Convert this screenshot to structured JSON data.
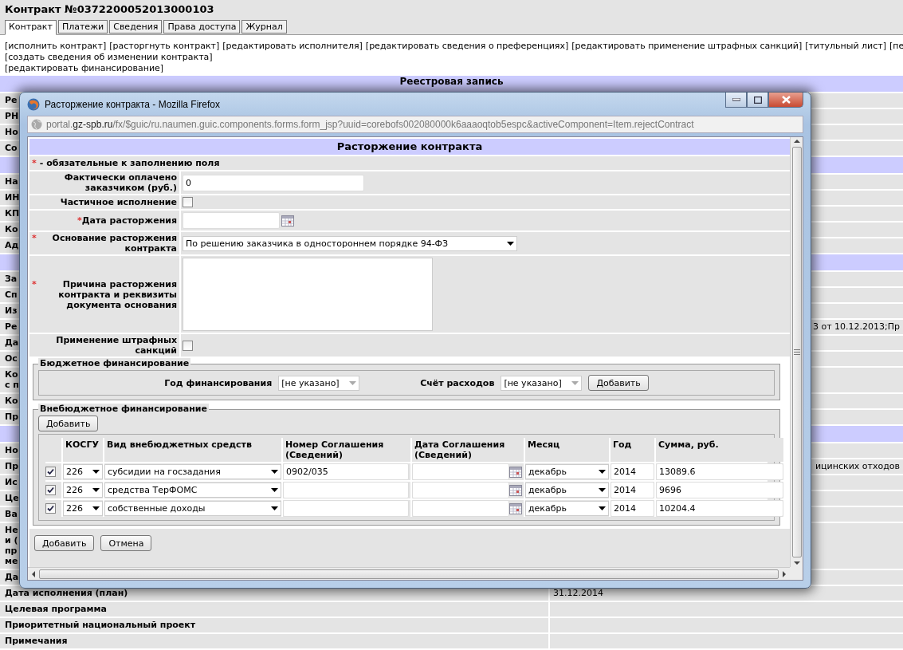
{
  "page": {
    "title": "Контракт №0372200052013000103",
    "tabs": [
      {
        "label": "Контракт",
        "selected": true
      },
      {
        "label": "Платежи",
        "selected": false
      },
      {
        "label": "Сведения",
        "selected": false
      },
      {
        "label": "Права доступа",
        "selected": false
      },
      {
        "label": "Журнал",
        "selected": false
      }
    ],
    "action_lines": [
      [
        "[исполнить контракт]",
        "[расторгнуть контракт]",
        "[редактировать исполнителя]",
        "[редактировать сведения о преференциях]",
        "[редактировать применение штрафных санкций]",
        "[титульный лист]",
        "[пе"
      ],
      [
        "[создать сведения об изменении контракта]"
      ],
      [
        "[редактировать финансирование]"
      ]
    ],
    "records": [
      {
        "kind": "section",
        "label": "Реестровая запись"
      },
      {
        "kind": "field",
        "label": "Ре"
      },
      {
        "kind": "field",
        "label": "РН"
      },
      {
        "kind": "field",
        "label": "Но"
      },
      {
        "kind": "field",
        "label": "Со"
      },
      {
        "kind": "section"
      },
      {
        "kind": "field",
        "label": "На"
      },
      {
        "kind": "field",
        "label": "ИН"
      },
      {
        "kind": "field",
        "label": "КП"
      },
      {
        "kind": "field",
        "label": "Ко"
      },
      {
        "kind": "field",
        "label": "Ад"
      },
      {
        "kind": "section"
      },
      {
        "kind": "field",
        "label": "За"
      },
      {
        "kind": "field",
        "label": "Сп"
      },
      {
        "kind": "field",
        "label": "Из"
      },
      {
        "kind": "field",
        "label": "Ре",
        "value": "3 от 10.12.2013;Пр"
      },
      {
        "kind": "field",
        "label": "Да"
      },
      {
        "kind": "field",
        "label": "Ос"
      },
      {
        "kind": "field",
        "label": "Ко\nс п"
      },
      {
        "kind": "field",
        "label": "Ко"
      },
      {
        "kind": "field",
        "label": "Пр"
      },
      {
        "kind": "section"
      },
      {
        "kind": "field",
        "label": "Но"
      },
      {
        "kind": "field",
        "label": "Пр",
        "value": "ицинских отходов"
      },
      {
        "kind": "field",
        "label": "Ис"
      },
      {
        "kind": "field",
        "label": "Це"
      },
      {
        "kind": "field",
        "label": "Ва"
      },
      {
        "kind": "field",
        "label": "Не\nи (\nпр\nме"
      },
      {
        "kind": "field",
        "label": "Да"
      },
      {
        "kind": "field",
        "label": "Дата исполнения (план)",
        "value": "31.12.2014"
      },
      {
        "kind": "field",
        "label": "Целевая программа"
      },
      {
        "kind": "field",
        "label": "Приоритетный национальный проект"
      },
      {
        "kind": "field",
        "label": "Примечания"
      }
    ]
  },
  "popup": {
    "title": "Расторжение контракта - Mozilla Firefox",
    "url": "portal.**gz-spb.ru**/fx/$guic/ru.naumen.guic.components.forms.form_jsp?uuid=corebofs002080000k6aaaoqtob5espc&activeComponent=Item.rejectContract",
    "header": "Расторжение контракта",
    "required_note": {
      "mark": "*",
      "text": "- обязательные к заполнению поля"
    },
    "fields": [
      {
        "kind": "text",
        "label": "Фактически оплачено заказчиком (руб.)",
        "value": "0"
      },
      {
        "kind": "checkbox",
        "label": "Частичное исполнение",
        "checked": false
      },
      {
        "kind": "date",
        "mark": "*",
        "label": "Дата расторжения"
      },
      {
        "kind": "select",
        "mark": "*",
        "label": "Основание расторжения контракта",
        "value": "По решению заказчика в одностороннем порядке 94-ФЗ"
      },
      {
        "kind": "textarea",
        "mark": "*",
        "label": "Причина расторжения контракта и реквизиты документа основания"
      },
      {
        "kind": "checkbox",
        "label": "Применение штрафных санкций",
        "checked": false
      }
    ],
    "budget": {
      "legend": "Бюджетное финансирование",
      "year_label": "Год финансирования",
      "year_value": "[не указано]",
      "account_label": "Счёт расходов",
      "account_value": "[не указано]",
      "button": "Добавить"
    },
    "extra": {
      "legend": "Внебюджетное финансирование",
      "add_button": "Добавить",
      "columns": [
        "КОСГУ",
        "Вид внебюджетных средств",
        "Номер Соглашения (Сведений)",
        "Дата Соглашения (Сведений)",
        "Месяц",
        "Год",
        "Сумма, руб."
      ],
      "rows": [
        {
          "checked": true,
          "kosgu": "226",
          "funds": "субсидии на госзадания",
          "agreement": "0902/035",
          "month": "декабрь",
          "year": "2014",
          "sum": "13089.6"
        },
        {
          "checked": true,
          "kosgu": "226",
          "funds": "средства ТерФОМС",
          "month": "декабрь",
          "year": "2014",
          "sum": "9696"
        },
        {
          "checked": true,
          "kosgu": "226",
          "funds": "собственные доходы",
          "month": "декабрь",
          "year": "2014",
          "sum": "10204.4"
        }
      ]
    },
    "buttons": [
      "Добавить",
      "Отмена"
    ]
  }
}
